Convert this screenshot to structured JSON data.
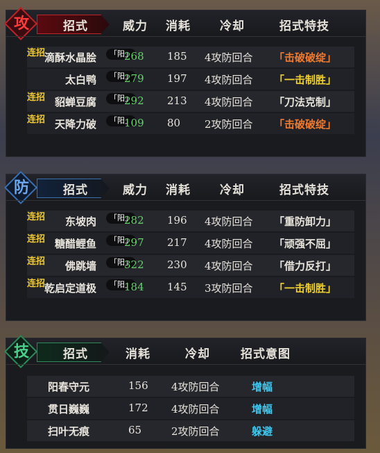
{
  "attack": {
    "badge": "攻",
    "headers": [
      "招式",
      "威力",
      "消耗",
      "冷却",
      "招式特技"
    ],
    "rows": [
      {
        "combo": "连招",
        "name": "滴酥水晶脍",
        "yang": "阳",
        "power": "268",
        "cost": "185",
        "cooldown": "4攻防回合",
        "skill": "「击破破绽」",
        "skill_color": "orange"
      },
      {
        "combo": "",
        "name": "太白鸭",
        "yang": "阳",
        "power": "279",
        "cost": "197",
        "cooldown": "4攻防回合",
        "skill": "「一击制胜」",
        "skill_color": "yellow"
      },
      {
        "combo": "连招",
        "name": "貂蝉豆腐",
        "yang": "阳",
        "power": "292",
        "cost": "213",
        "cooldown": "4攻防回合",
        "skill": "「刀法克制」",
        "skill_color": "white"
      },
      {
        "combo": "连招",
        "name": "天降力破",
        "yang": "阳",
        "power": "109",
        "cost": "80",
        "cooldown": "2攻防回合",
        "skill": "「击破破绽」",
        "skill_color": "orange"
      }
    ]
  },
  "defense": {
    "badge": "防",
    "headers": [
      "招式",
      "威力",
      "消耗",
      "冷却",
      "招式特技"
    ],
    "rows": [
      {
        "combo": "连招",
        "name": "东坡肉",
        "yang": "阳",
        "power": "282",
        "cost": "196",
        "cooldown": "4攻防回合",
        "skill": "「重防卸力」",
        "skill_color": "white"
      },
      {
        "combo": "连招",
        "name": "糖醋鲤鱼",
        "yang": "阳",
        "power": "297",
        "cost": "217",
        "cooldown": "4攻防回合",
        "skill": "「顽强不屈」",
        "skill_color": "white"
      },
      {
        "combo": "连招",
        "name": "佛跳墙",
        "yang": "阳",
        "power": "322",
        "cost": "230",
        "cooldown": "4攻防回合",
        "skill": "「借力反打」",
        "skill_color": "white"
      },
      {
        "combo": "连招",
        "name": "乾启定道极",
        "yang": "阳",
        "power": "184",
        "cost": "145",
        "cooldown": "3攻防回合",
        "skill": "「一击制胜」",
        "skill_color": "yellow"
      }
    ]
  },
  "technique": {
    "badge": "技",
    "headers": [
      "招式",
      "消耗",
      "冷却",
      "招式意图"
    ],
    "rows": [
      {
        "name": "阳春守元",
        "cost": "156",
        "cooldown": "4攻防回合",
        "intent": "增幅"
      },
      {
        "name": "贯日巍巍",
        "cost": "172",
        "cooldown": "4攻防回合",
        "intent": "增幅"
      },
      {
        "name": "扫叶无痕",
        "cost": "65",
        "cooldown": "2攻防回合",
        "intent": "躲避"
      }
    ]
  },
  "colors": {
    "attack_accent": "#c0232a",
    "defense_accent": "#3a6fb0",
    "technique_accent": "#2f8a5a",
    "power": "#66d06a",
    "orange_skill": "#f07a2e",
    "yellow_skill": "#f0d030",
    "intent": "#3ec8f0"
  }
}
